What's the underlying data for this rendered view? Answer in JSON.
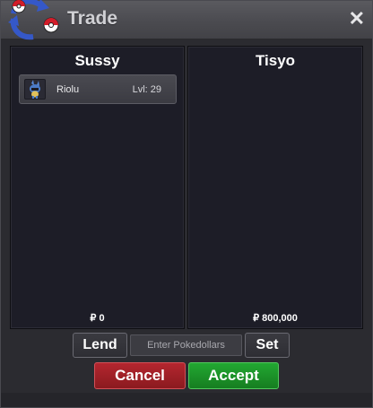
{
  "window": {
    "title": "Trade",
    "close_label": "✕"
  },
  "left_panel": {
    "player_name": "Sussy",
    "pokemon": [
      {
        "name": "Riolu",
        "level": "Lvl: 29",
        "icon": "riolu-icon"
      }
    ],
    "money": "₽ 0"
  },
  "right_panel": {
    "player_name": "Tisyo",
    "money": "₽ 800,000"
  },
  "controls": {
    "lend_label": "Lend",
    "pokedollars_placeholder": "Enter Pokedollars",
    "set_label": "Set",
    "cancel_label": "Cancel",
    "accept_label": "Accept"
  },
  "colors": {
    "cancel": "#a0222a",
    "accept": "#1e9a2c",
    "panel_bg": "#1d1d27"
  }
}
